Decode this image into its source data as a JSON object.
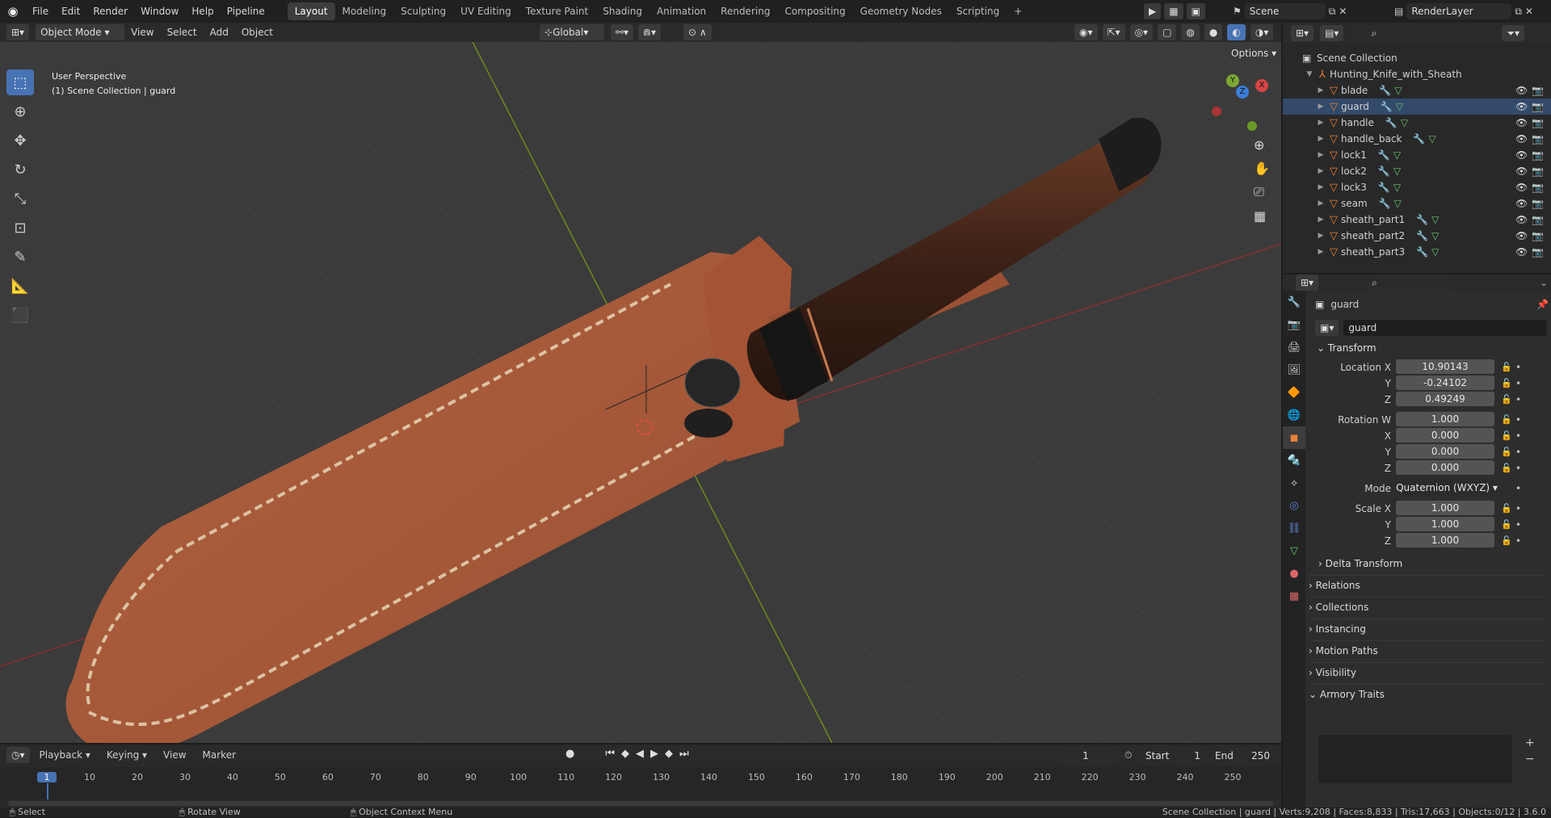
{
  "topbar": {
    "menus": [
      "File",
      "Edit",
      "Render",
      "Window",
      "Help",
      "Pipeline"
    ],
    "workspaces": [
      "Layout",
      "Modeling",
      "Sculpting",
      "UV Editing",
      "Texture Paint",
      "Shading",
      "Animation",
      "Rendering",
      "Compositing",
      "Geometry Nodes",
      "Scripting"
    ],
    "active_workspace": "Layout",
    "scene": "Scene",
    "render_layer": "RenderLayer"
  },
  "viewport_header": {
    "mode": "Object Mode",
    "menus": [
      "View",
      "Select",
      "Add",
      "Object"
    ],
    "orientation": "Global",
    "options": "Options"
  },
  "viewport": {
    "overlay_line1": "User Perspective",
    "overlay_line2": "(1) Scene Collection | guard",
    "gizmo_axes": [
      "X",
      "Y",
      "Z"
    ]
  },
  "outliner": {
    "root": "Scene Collection",
    "collection": "Hunting_Knife_with_Sheath",
    "objects": [
      "blade",
      "guard",
      "handle",
      "handle_back",
      "lock1",
      "lock2",
      "lock3",
      "seam",
      "sheath_part1",
      "sheath_part2",
      "sheath_part3"
    ],
    "selected": "guard"
  },
  "properties": {
    "object_name": "guard",
    "datablock": "guard",
    "section_transform": "Transform",
    "location_label": "Location X",
    "location": {
      "x": "10.90143",
      "y": "-0.24102",
      "z": "0.49249"
    },
    "rotation_label": "Rotation W",
    "rotation": {
      "w": "1.000",
      "x": "0.000",
      "y": "0.000",
      "z": "0.000"
    },
    "mode_label": "Mode",
    "mode": "Quaternion (WXYZ)",
    "scale_label": "Scale X",
    "scale": {
      "x": "1.000",
      "y": "1.000",
      "z": "1.000"
    },
    "axis_labels": {
      "y": "Y",
      "z": "Z",
      "x": "X"
    },
    "panels": [
      "Delta Transform",
      "Relations",
      "Collections",
      "Instancing",
      "Motion Paths",
      "Visibility",
      "Armory Traits"
    ]
  },
  "timeline": {
    "menus": [
      "Playback",
      "Keying",
      "View",
      "Marker"
    ],
    "current_frame": "1",
    "start_label": "Start",
    "start": "1",
    "end_label": "End",
    "end": "250",
    "ruler": [
      "1",
      "10",
      "20",
      "30",
      "40",
      "50",
      "60",
      "70",
      "80",
      "90",
      "100",
      "110",
      "120",
      "130",
      "140",
      "150",
      "160",
      "170",
      "180",
      "190",
      "200",
      "210",
      "220",
      "230",
      "240",
      "250"
    ]
  },
  "statusbar": {
    "select": "Select",
    "rotate": "Rotate View",
    "context": "Object Context Menu",
    "stats": "Scene Collection | guard | Verts:9,208 | Faces:8,833 | Tris:17,663 | Objects:0/12 | 3.6.0"
  },
  "colors": {
    "accent": "#4772b3",
    "object_orange": "#e8803a",
    "leather": "#a65a3a",
    "handle_brown": "#4a2a1e"
  }
}
